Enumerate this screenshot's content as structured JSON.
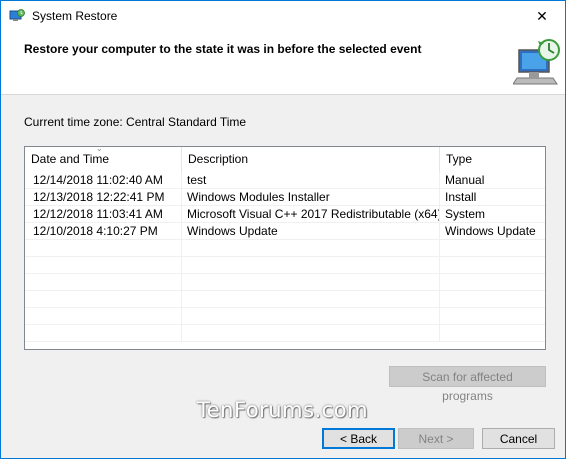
{
  "window": {
    "title": "System Restore",
    "close_glyph": "✕",
    "app_icon": "system-restore-icon"
  },
  "header": {
    "title": "Restore your computer to the state it was in before the selected event",
    "graphic_icon": "computer-restore-icon"
  },
  "timezone": {
    "label": "Current time zone: Central Standard Time"
  },
  "table": {
    "columns": {
      "date": "Date and Time",
      "description": "Description",
      "type": "Type"
    },
    "rows": [
      {
        "date": "12/14/2018 11:02:40 AM",
        "description": "test",
        "type": "Manual"
      },
      {
        "date": "12/13/2018 12:22:41 PM",
        "description": "Windows Modules Installer",
        "type": "Install"
      },
      {
        "date": "12/12/2018 11:03:41 AM",
        "description": "Microsoft Visual C++ 2017 Redistributable (x64) ...",
        "type": "System"
      },
      {
        "date": "12/10/2018 4:10:27 PM",
        "description": "Windows Update",
        "type": "Windows Update"
      }
    ]
  },
  "buttons": {
    "scan": "Scan for affected programs",
    "back": "< Back",
    "next": "Next >",
    "cancel": "Cancel"
  },
  "watermark": "TenForums.com",
  "colors": {
    "highlight": "#ffff00",
    "accent": "#0078d7"
  }
}
